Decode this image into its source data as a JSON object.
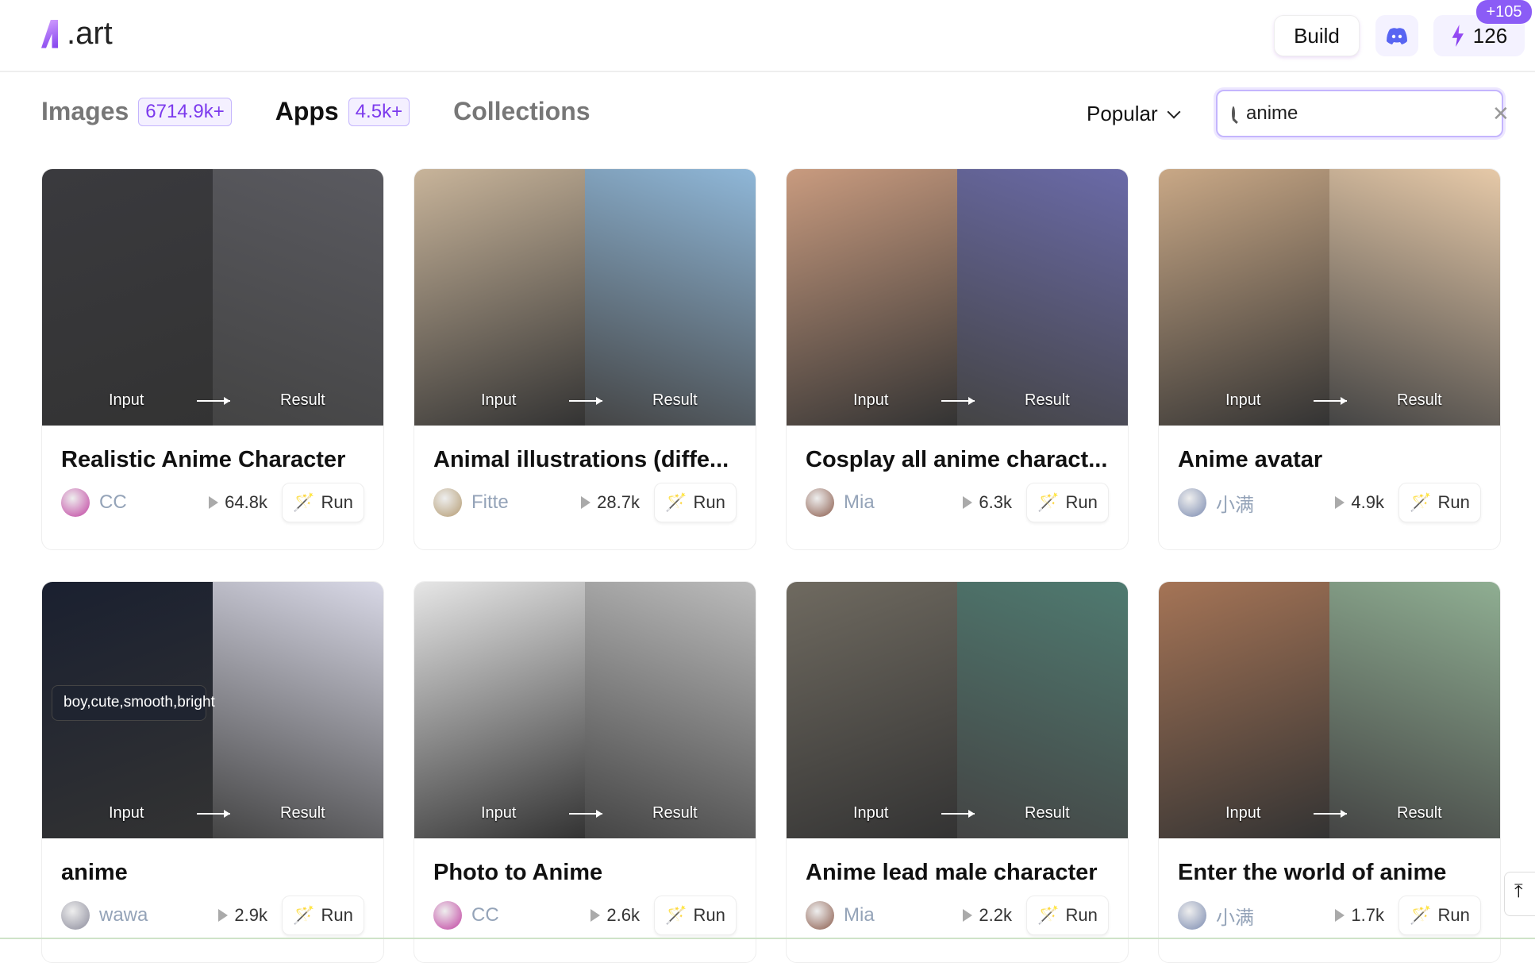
{
  "header": {
    "logo": ".art",
    "build": "Build",
    "credits": "126",
    "credits_bonus": "+105"
  },
  "tabs": [
    {
      "label": "Images",
      "count": "6714.9k+"
    },
    {
      "label": "Apps",
      "count": "4.5k+",
      "active": true
    },
    {
      "label": "Collections"
    }
  ],
  "sort": {
    "selected": "Popular"
  },
  "search": {
    "value": "anime"
  },
  "accent": "#7c3aed",
  "labels": {
    "input": "Input",
    "result": "Result",
    "run": "Run"
  },
  "cards": [
    {
      "title": "Realistic Anime Character",
      "author": "CC",
      "plays": "64.8k"
    },
    {
      "title": "Animal illustrations (diffe...",
      "author": "Fitte",
      "plays": "28.7k"
    },
    {
      "title": "Cosplay all anime charact...",
      "author": "Mia",
      "plays": "6.3k"
    },
    {
      "title": "Anime avatar",
      "author": "小满",
      "plays": "4.9k"
    },
    {
      "title": "anime",
      "author": "wawa",
      "plays": "2.9k",
      "prompt": "boy,cute,smooth,bright"
    },
    {
      "title": "Photo to Anime",
      "author": "CC",
      "plays": "2.6k"
    },
    {
      "title": "Anime lead male character",
      "author": "Mia",
      "plays": "2.2k"
    },
    {
      "title": "Enter the world of anime",
      "author": "小满",
      "plays": "1.7k"
    }
  ]
}
